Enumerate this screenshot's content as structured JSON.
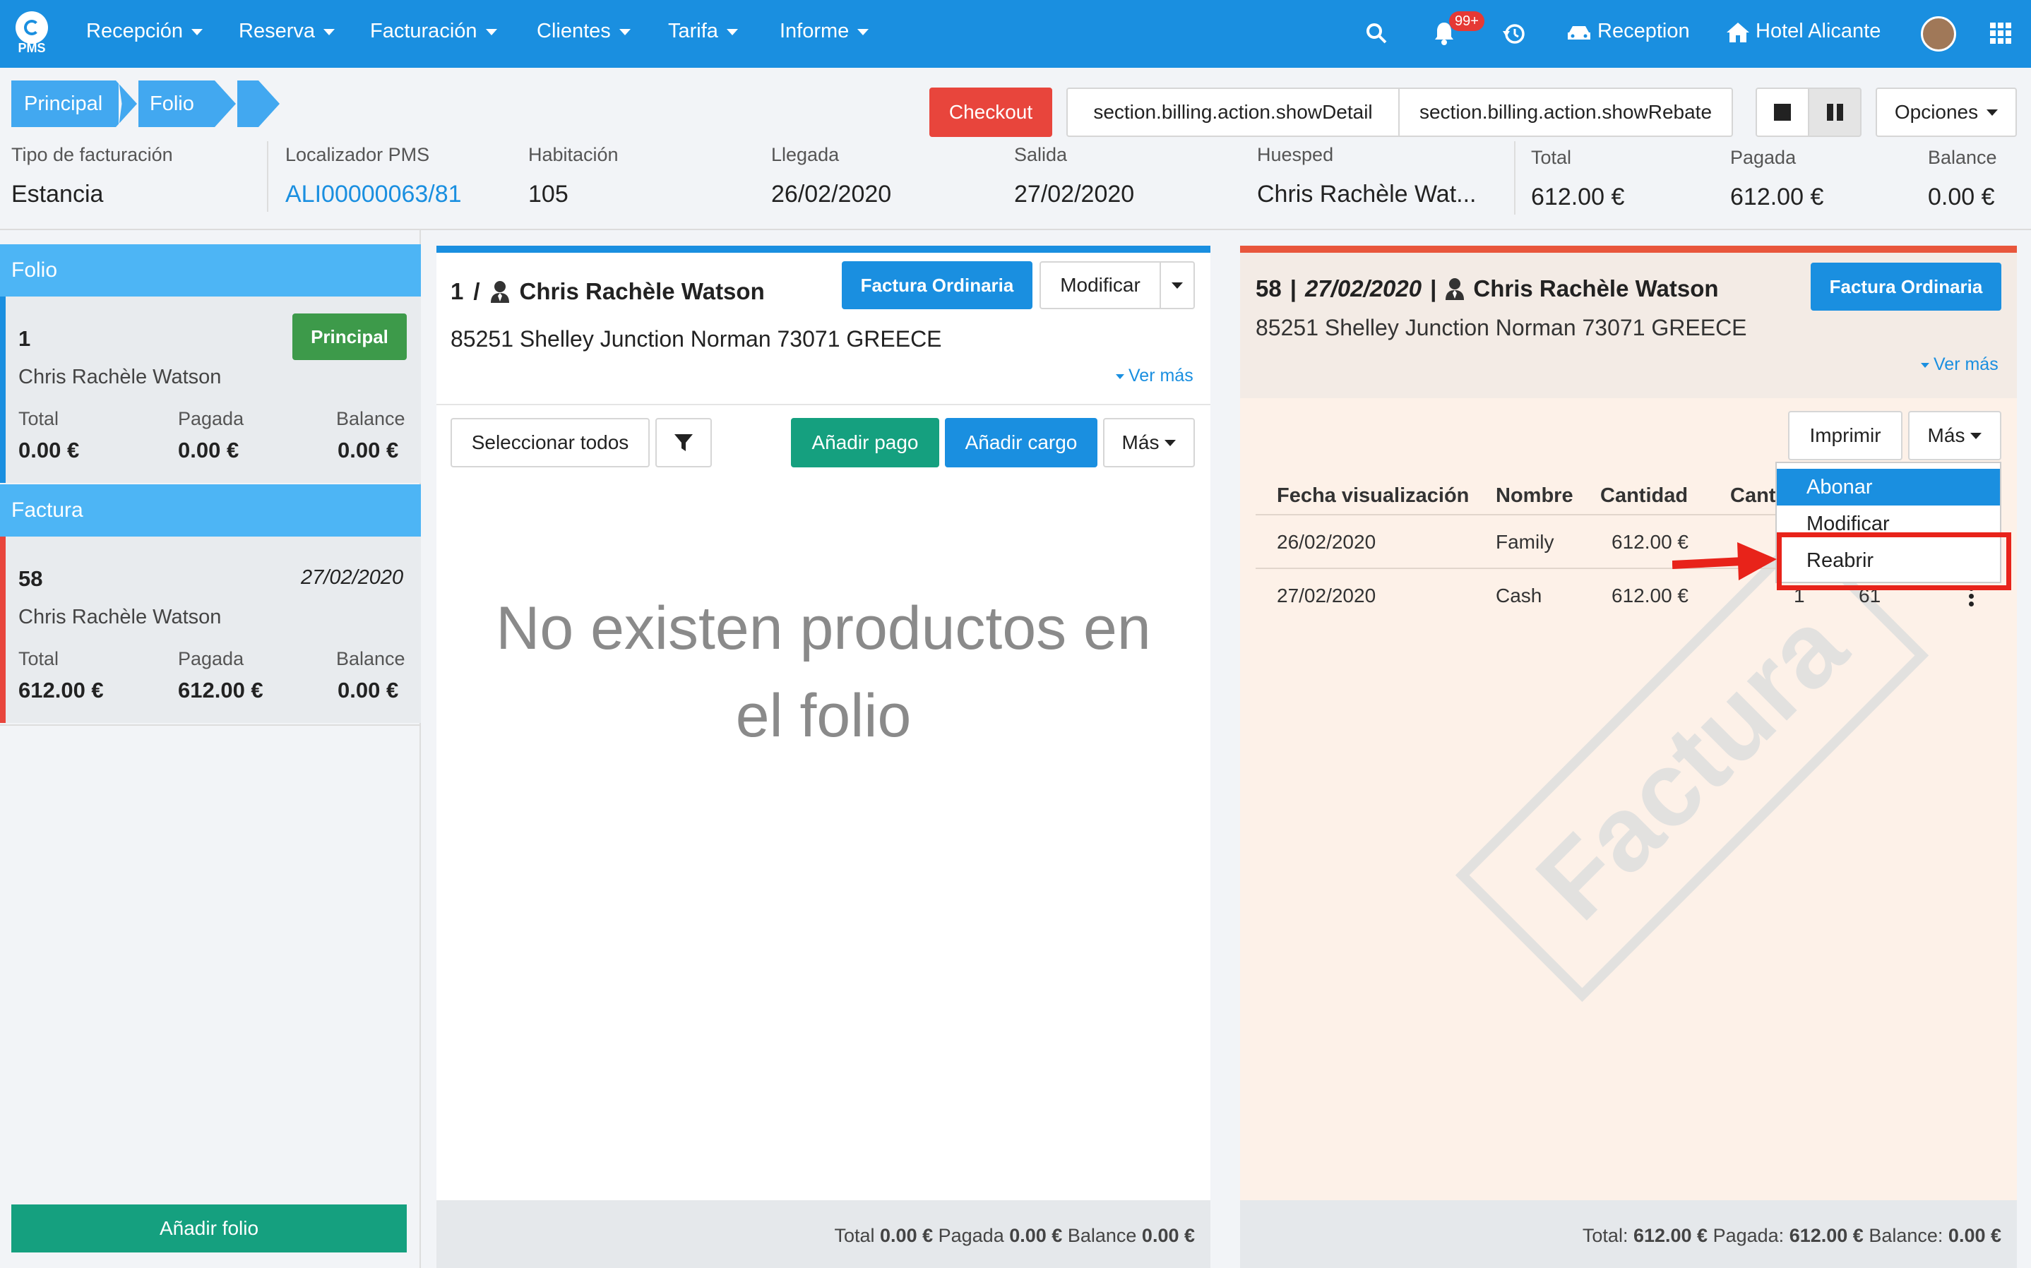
{
  "nav": {
    "logo_text": "PMS",
    "menu": [
      "Recepción",
      "Reserva",
      "Facturación",
      "Clientes",
      "Tarifa",
      "Informe"
    ],
    "notifications_badge": "99+",
    "reception_label": "Reception",
    "hotel_label": "Hotel Alicante"
  },
  "breadcrumb": [
    "Principal",
    "Folio"
  ],
  "toolbar": {
    "checkout": "Checkout",
    "show_detail": "section.billing.action.showDetail",
    "show_rebate": "section.billing.action.showRebate",
    "options": "Opciones"
  },
  "info": {
    "tipo_label": "Tipo de facturación",
    "tipo_value": "Estancia",
    "localizador_label": "Localizador PMS",
    "localizador_value": "ALI00000063/81",
    "habitacion_label": "Habitación",
    "habitacion_value": "105",
    "llegada_label": "Llegada",
    "llegada_value": "26/02/2020",
    "salida_label": "Salida",
    "salida_value": "27/02/2020",
    "huesped_label": "Huesped",
    "huesped_value": "Chris Rachèle Wat...",
    "total_label": "Total",
    "total_value": "612.00 €",
    "pagada_label": "Pagada",
    "pagada_value": "612.00 €",
    "balance_label": "Balance",
    "balance_value": "0.00 €"
  },
  "sidebar": {
    "folio_header": "Folio",
    "folio_card": {
      "number": "1",
      "badge": "Principal",
      "name": "Chris Rachèle Watson",
      "total_label": "Total",
      "total": "0.00 €",
      "pagada_label": "Pagada",
      "pagada": "0.00 €",
      "balance_label": "Balance",
      "balance": "0.00 €"
    },
    "factura_header": "Factura",
    "factura_card": {
      "number": "58",
      "date": "27/02/2020",
      "name": "Chris Rachèle Watson",
      "total_label": "Total",
      "total": "612.00 €",
      "pagada_label": "Pagada",
      "pagada": "612.00 €",
      "balance_label": "Balance",
      "balance": "0.00 €"
    },
    "add_folio": "Añadir folio"
  },
  "folio_panel": {
    "number": "1",
    "separator": "/",
    "guest": "Chris Rachèle Watson",
    "type_button": "Factura Ordinaria",
    "modify": "Modificar",
    "address": "85251 Shelley Junction Norman 73071 GREECE",
    "ver_mas": "Ver más",
    "select_all": "Seleccionar todos",
    "add_payment": "Añadir pago",
    "add_charge": "Añadir cargo",
    "more": "Más",
    "empty_message_1": "No existen productos en",
    "empty_message_2": "el folio",
    "footer_total_label": "Total",
    "footer_total": "0.00 €",
    "footer_pagada_label": "Pagada",
    "footer_pagada": "0.00 €",
    "footer_balance_label": "Balance",
    "footer_balance": "0.00 €"
  },
  "invoice_panel": {
    "number": "58",
    "date": "27/02/2020",
    "guest": "Chris Rachèle Watson",
    "type_button": "Factura Ordinaria",
    "address": "85251 Shelley Junction Norman 73071 GREECE",
    "ver_mas": "Ver más",
    "print": "Imprimir",
    "more": "Más",
    "watermark": "Factura",
    "columns": [
      "Fecha visualización",
      "Nombre",
      "Cantidad",
      "Cant"
    ],
    "rows": [
      {
        "date": "26/02/2020",
        "name": "Family",
        "amount": "612.00 €",
        "extra1": "",
        "extra2": ""
      },
      {
        "date": "27/02/2020",
        "name": "Cash",
        "amount": "612.00 €",
        "extra1": "1",
        "extra2": "61"
      }
    ],
    "dropdown": [
      "Abonar",
      "Modificar",
      "Reabrir"
    ],
    "footer_total_label": "Total:",
    "footer_total": "612.00 €",
    "footer_pagada_label": "Pagada:",
    "footer_pagada": "612.00 €",
    "footer_balance_label": "Balance:",
    "footer_balance": "0.00 €"
  },
  "colors": {
    "primary": "#1a8fe0",
    "teal": "#15a07f",
    "red": "#e8453c",
    "green": "#3d9a4a",
    "highlight": "#e8231a"
  }
}
